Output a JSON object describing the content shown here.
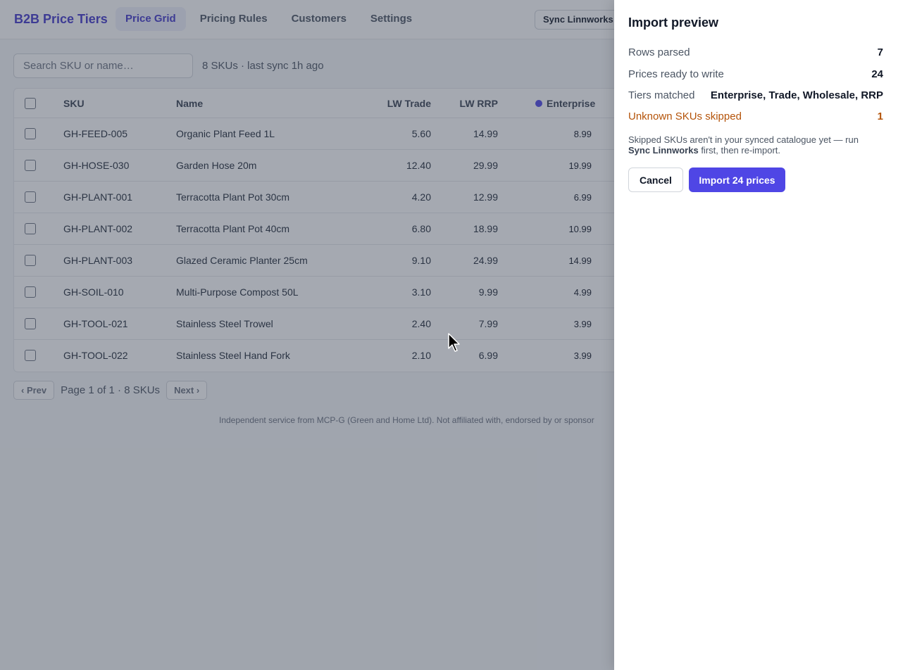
{
  "header": {
    "brand": "B2B Price Tiers",
    "tabs": [
      {
        "label": "Price Grid"
      },
      {
        "label": "Pricing Rules"
      },
      {
        "label": "Customers"
      },
      {
        "label": "Settings"
      }
    ],
    "sync_button": "Sync Linnworks"
  },
  "toolbar": {
    "search_placeholder": "Search SKU or name…",
    "sku_count": "8 SKUs · last sync 1h ago"
  },
  "table": {
    "columns": {
      "sku": "SKU",
      "name": "Name",
      "lw_trade": "LW Trade",
      "lw_rrp": "LW RRP",
      "enterprise": "Enterprise"
    },
    "rows": [
      {
        "sku": "GH-FEED-005",
        "name": "Organic Plant Feed 1L",
        "lw_trade": "5.60",
        "lw_rrp": "14.99",
        "enterprise": "8.99"
      },
      {
        "sku": "GH-HOSE-030",
        "name": "Garden Hose 20m",
        "lw_trade": "12.40",
        "lw_rrp": "29.99",
        "enterprise": "19.99"
      },
      {
        "sku": "GH-PLANT-001",
        "name": "Terracotta Plant Pot 30cm",
        "lw_trade": "4.20",
        "lw_rrp": "12.99",
        "enterprise": "6.99"
      },
      {
        "sku": "GH-PLANT-002",
        "name": "Terracotta Plant Pot 40cm",
        "lw_trade": "6.80",
        "lw_rrp": "18.99",
        "enterprise": "10.99"
      },
      {
        "sku": "GH-PLANT-003",
        "name": "Glazed Ceramic Planter 25cm",
        "lw_trade": "9.10",
        "lw_rrp": "24.99",
        "enterprise": "14.99"
      },
      {
        "sku": "GH-SOIL-010",
        "name": "Multi-Purpose Compost 50L",
        "lw_trade": "3.10",
        "lw_rrp": "9.99",
        "enterprise": "4.99"
      },
      {
        "sku": "GH-TOOL-021",
        "name": "Stainless Steel Trowel",
        "lw_trade": "2.40",
        "lw_rrp": "7.99",
        "enterprise": "3.99"
      },
      {
        "sku": "GH-TOOL-022",
        "name": "Stainless Steel Hand Fork",
        "lw_trade": "2.10",
        "lw_rrp": "6.99",
        "enterprise": "3.99"
      }
    ]
  },
  "pager": {
    "prev": "‹ Prev",
    "info": "Page 1 of 1 · 8 SKUs",
    "next": "Next ›"
  },
  "footer": "Independent service from MCP-G (Green and Home Ltd). Not affiliated with, endorsed by or sponsor",
  "drawer": {
    "title": "Import preview",
    "stats": [
      {
        "label": "Rows parsed",
        "value": "7"
      },
      {
        "label": "Prices ready to write",
        "value": "24"
      },
      {
        "label": "Tiers matched",
        "value": "Enterprise, Trade, Wholesale, RRP"
      },
      {
        "label": "Unknown SKUs skipped",
        "value": "1"
      }
    ],
    "note": {
      "before": "Skipped SKUs aren't in your synced catalogue yet — run ",
      "bold": "Sync Linnworks",
      "after": " first, then re-import."
    },
    "cancel_label": "Cancel",
    "import_label": "Import 24 prices"
  },
  "colors": {
    "accent": "#4f46e5",
    "brand": "#4338ca",
    "warning": "#b45309"
  }
}
